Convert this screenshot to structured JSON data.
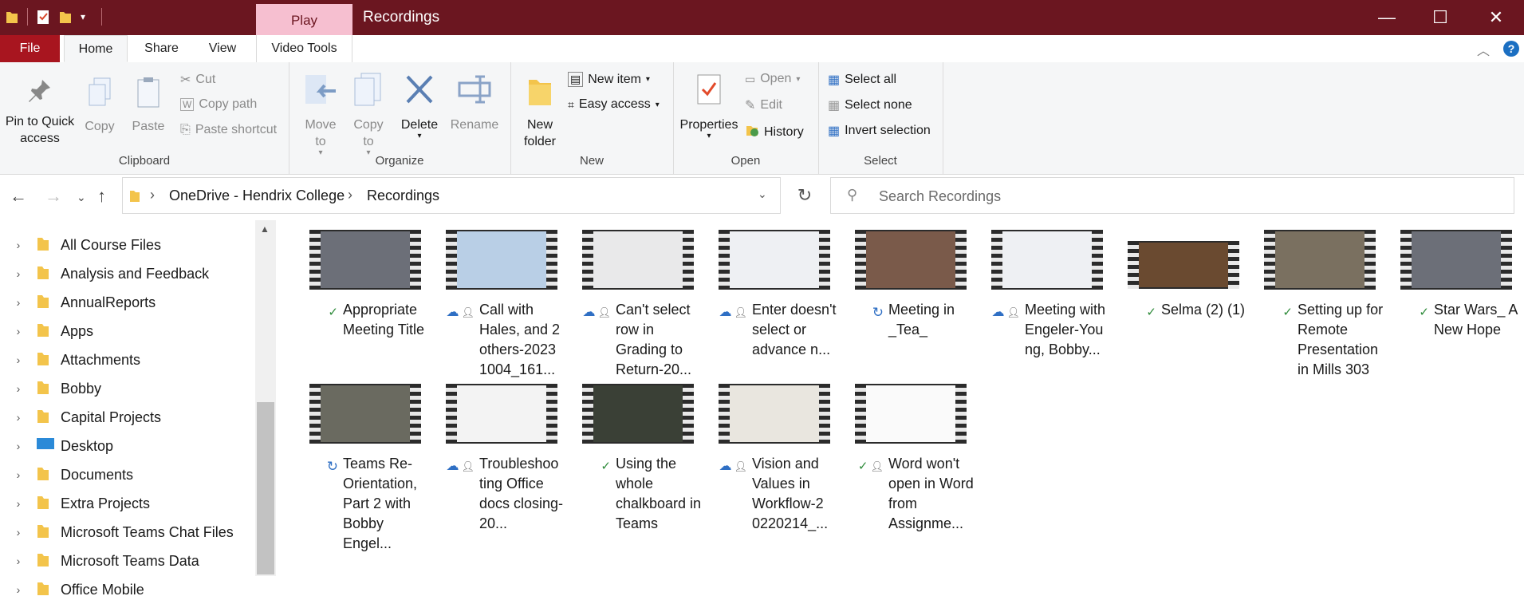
{
  "window": {
    "title": "Recordings",
    "context_tab": "Play",
    "minimize": "—",
    "maximize": "☐",
    "close": "✕"
  },
  "tabs": {
    "file": "File",
    "home": "Home",
    "share": "Share",
    "view": "View",
    "video_tools": "Video Tools"
  },
  "ribbon": {
    "clipboard": {
      "label": "Clipboard",
      "pin": "Pin to Quick access",
      "copy": "Copy",
      "paste": "Paste",
      "cut": "Cut",
      "copy_path": "Copy path",
      "paste_shortcut": "Paste shortcut"
    },
    "organize": {
      "label": "Organize",
      "move_to": "Move to",
      "copy_to": "Copy to",
      "delete": "Delete",
      "rename": "Rename"
    },
    "new": {
      "label": "New",
      "new_folder": "New folder",
      "new_item": "New item",
      "easy_access": "Easy access"
    },
    "open": {
      "label": "Open",
      "properties": "Properties",
      "open": "Open",
      "edit": "Edit",
      "history": "History"
    },
    "select": {
      "label": "Select",
      "select_all": "Select all",
      "select_none": "Select none",
      "invert_selection": "Invert selection"
    }
  },
  "address": {
    "segments": [
      "OneDrive - Hendrix College",
      "Recordings"
    ],
    "separator": "›"
  },
  "search": {
    "placeholder": "Search Recordings"
  },
  "nav_items": [
    "All Course Files",
    "Analysis and Feedback",
    "AnnualReports",
    "Apps",
    "Attachments",
    "Bobby",
    "Capital Projects",
    "Desktop",
    "Documents",
    "Extra Projects",
    "Microsoft Teams Chat Files",
    "Microsoft Teams Data",
    "Office Mobile"
  ],
  "files": [
    {
      "name": "Appropriate Meeting Title",
      "status": "synced",
      "shared": false
    },
    {
      "name": "Call with Hales, and 2 others-2023 1004_161...",
      "status": "cloud",
      "shared": true
    },
    {
      "name": "Can't select row in Grading to Return-20...",
      "status": "cloud",
      "shared": true
    },
    {
      "name": "Enter doesn't select or advance n...",
      "status": "cloud",
      "shared": true
    },
    {
      "name": "Meeting in _Tea_",
      "status": "syncing",
      "shared": false
    },
    {
      "name": "Meeting with Engeler-You ng, Bobby...",
      "status": "cloud",
      "shared": true
    },
    {
      "name": "Selma (2) (1)",
      "status": "synced",
      "shared": false
    },
    {
      "name": "Setting up for Remote Presentation in Mills 303",
      "status": "synced",
      "shared": false
    },
    {
      "name": "Star Wars_ A New Hope",
      "status": "synced",
      "shared": false
    },
    {
      "name": "Teams Re-Orientation, Part 2 with Bobby Engel...",
      "status": "syncing",
      "shared": false
    },
    {
      "name": "Troubleshoo ting Office docs closing-20...",
      "status": "cloud",
      "shared": true
    },
    {
      "name": "Using the whole chalkboard in Teams",
      "status": "synced",
      "shared": false
    },
    {
      "name": "Vision and Values in Workflow-2 0220214_...",
      "status": "cloud",
      "shared": true
    },
    {
      "name": "Word won't open in Word from Assignme...",
      "status": "synced",
      "shared": true
    }
  ]
}
